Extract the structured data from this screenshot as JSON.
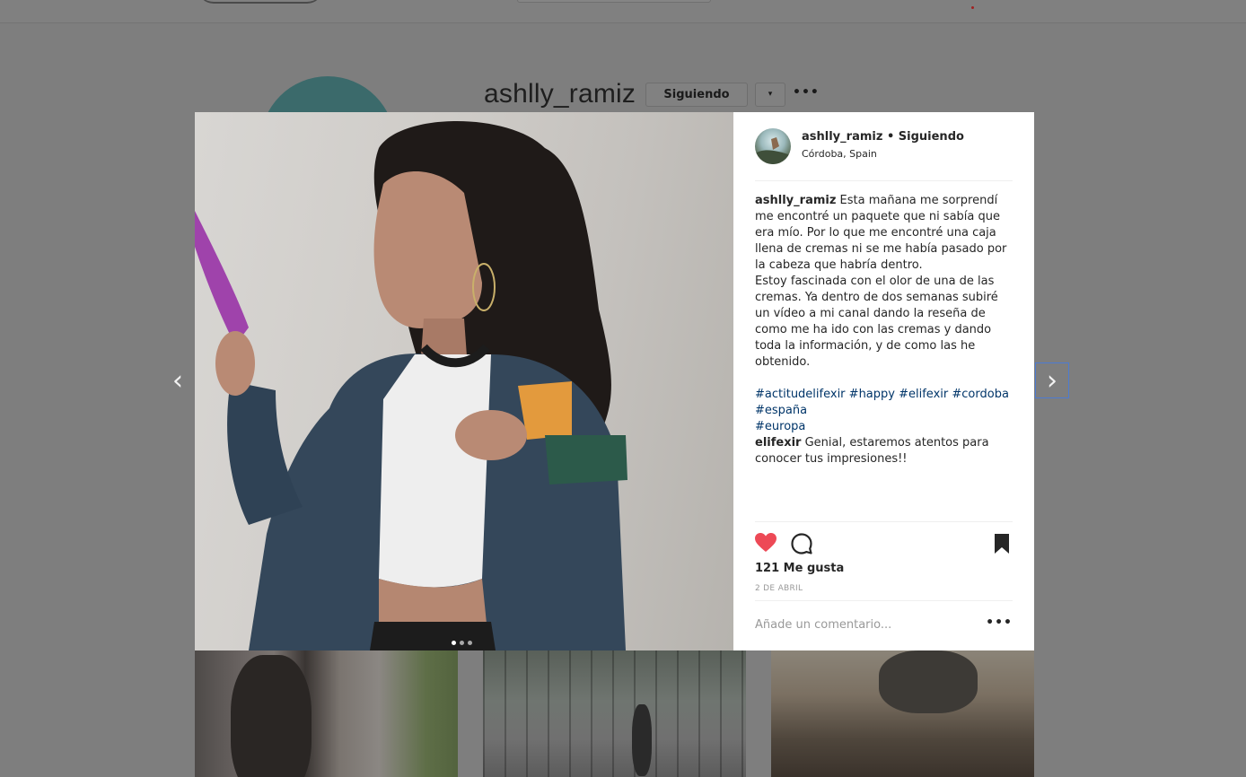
{
  "profile": {
    "username": "ashlly_ramiz",
    "following_label": "Siguiendo",
    "dropdown_icon": "▾",
    "more_icon": "•••"
  },
  "post": {
    "header": {
      "username": "ashlly_ramiz",
      "separator": "•",
      "follow_status": "Siguiendo",
      "location": "Córdoba, Spain"
    },
    "caption": {
      "username": "ashlly_ramiz",
      "text_1": "Esta mañana me sorprendí me encontré un paquete que ni sabía que era mío. Por lo que me encontré una caja llena de cremas ni se me había pasado por la cabeza que habría dentro.",
      "text_2": "Estoy fascinada con el olor de una de las cremas. Ya dentro de dos semanas subiré un vídeo a mi canal dando la reseña de como me ha ido con las cremas y dando toda la información, y de como las he obtenido.",
      "hashtags_line1": [
        "#actitudelifexir",
        "#happy",
        "#elifexir",
        "#cordoba"
      ],
      "hashtags_line2": [
        "#españa"
      ],
      "hashtags_line3": [
        "#europa"
      ]
    },
    "reply": {
      "username": "elifexir",
      "text": "Genial, estaremos atentos para conocer tus impresiones!!"
    },
    "likes_label": "121 Me gusta",
    "date_label": "2 DE ABRIL",
    "comment_placeholder": "Añade un comentario...",
    "options_icon": "•••",
    "carousel": {
      "count": 3,
      "active_index": 0
    },
    "icons": {
      "like": "heart-filled",
      "comment": "speech-bubble",
      "save": "bookmark-filled",
      "prev": "chevron-left",
      "next": "chevron-right"
    },
    "colors": {
      "like": "#ed4956",
      "hashtag": "#003569",
      "text": "#262626",
      "muted": "#999999"
    }
  },
  "nav": {
    "prev_glyph": "‹",
    "next_glyph": "›"
  }
}
